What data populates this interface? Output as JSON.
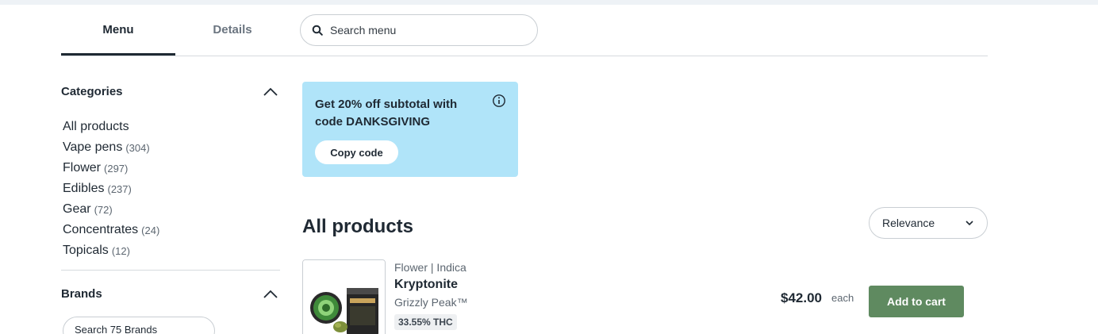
{
  "tabs": [
    {
      "label": "Menu",
      "active": true
    },
    {
      "label": "Details",
      "active": false
    }
  ],
  "search": {
    "placeholder": "Search menu",
    "icon": "search-icon"
  },
  "sidebar": {
    "categories_heading": "Categories",
    "categories": [
      {
        "label": "All products",
        "count": ""
      },
      {
        "label": "Vape pens",
        "count": "(304)"
      },
      {
        "label": "Flower",
        "count": "(297)"
      },
      {
        "label": "Edibles",
        "count": "(237)"
      },
      {
        "label": "Gear",
        "count": "(72)"
      },
      {
        "label": "Concentrates",
        "count": "(24)"
      },
      {
        "label": "Topicals",
        "count": "(12)"
      }
    ],
    "brands_heading": "Brands",
    "brand_search_placeholder": "Search 75 Brands"
  },
  "promo": {
    "text": "Get 20% off subtotal with code DANKSGIVING",
    "copy_label": "Copy code",
    "background": "#b0e4f9"
  },
  "products": {
    "title": "All products",
    "sort": {
      "selected": "Relevance"
    },
    "items": [
      {
        "category": "Flower | Indica",
        "name": "Kryptonite",
        "brand": "Grizzly Peak™",
        "thc": "33.55% THC",
        "price": "$42.00",
        "unit": "each",
        "add_label": "Add to cart"
      }
    ]
  },
  "colors": {
    "accent_button": "#5f8a60",
    "text": "#1f2933",
    "muted": "#5c6670"
  }
}
